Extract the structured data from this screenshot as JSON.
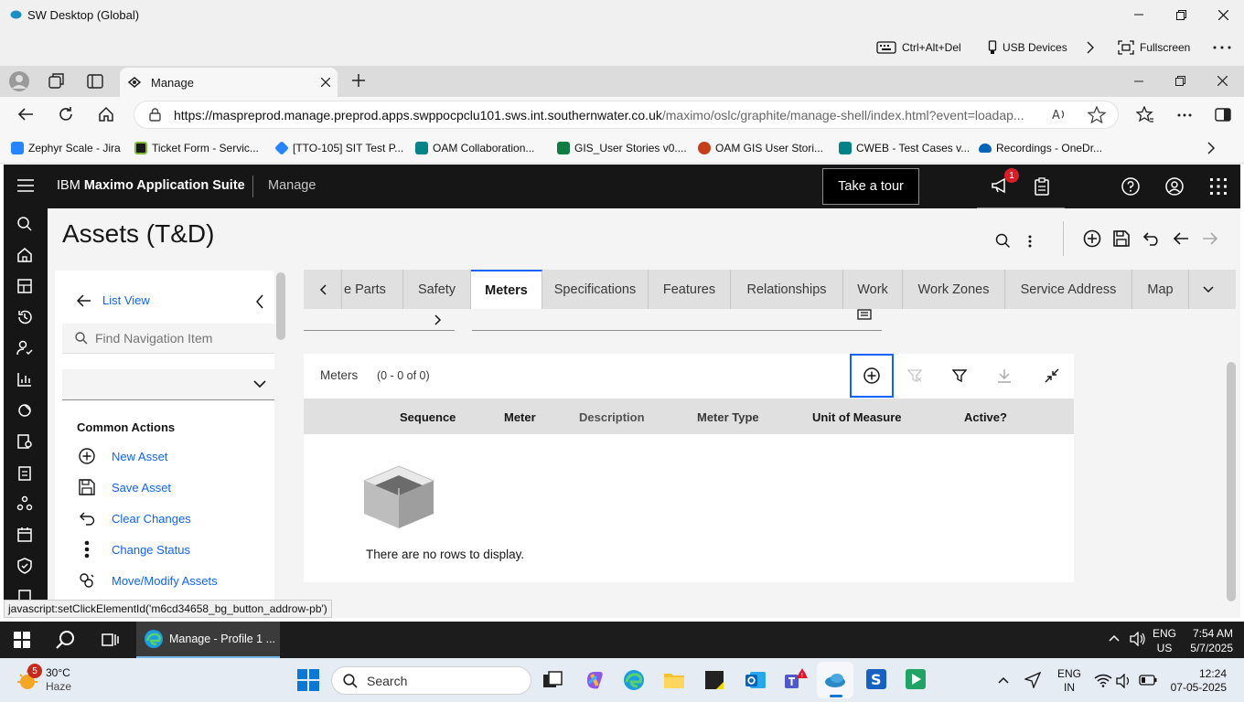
{
  "sw_window": {
    "title": "SW Desktop (Global)",
    "toolbar": {
      "ctrl_alt_del": "Ctrl+Alt+Del",
      "usb": "USB Devices",
      "fullscreen": "Fullscreen"
    }
  },
  "browser": {
    "tab_title": "Manage",
    "url_host": "https://maspreprod.manage.preprod.apps.swppocpclu101.sws.int.southernwater.co.uk",
    "url_path": "/maximo/oslc/graphite/manage-shell/index.html?event=loadap...",
    "favorites": [
      {
        "label": "Zephyr Scale - Jira",
        "color": "#2684ff"
      },
      {
        "label": "Ticket Form - Servic...",
        "color": "#1a1a1a"
      },
      {
        "label": "[TTO-105] SIT Test P...",
        "color": "#2684ff"
      },
      {
        "label": "OAM Collaboration...",
        "color": "#038387"
      },
      {
        "label": "GIS_User Stories v0....",
        "color": "#107c41"
      },
      {
        "label": "OAM GIS User Stori...",
        "color": "#c43e1c"
      },
      {
        "label": "CWEB - Test Cases v...",
        "color": "#038387"
      },
      {
        "label": "Recordings - OneDr...",
        "color": "#0364b8"
      }
    ]
  },
  "maximo": {
    "brand_plain": "IBM ",
    "brand_bold": "Maximo Application Suite",
    "app": "Manage",
    "tour_button": "Take a tour",
    "notification_count": "1",
    "page_title": "Assets (T&D)",
    "nav": {
      "list_view": "List View",
      "search_placeholder": "Find Navigation Item",
      "section_title": "Common Actions",
      "actions": [
        {
          "label": "New Asset",
          "icon": "add-circle-icon"
        },
        {
          "label": "Save Asset",
          "icon": "save-icon"
        },
        {
          "label": "Clear Changes",
          "icon": "undo-icon"
        },
        {
          "label": "Change Status",
          "icon": "overflow-vertical-icon"
        },
        {
          "label": "Move/Modify Assets",
          "icon": "move-icon"
        }
      ]
    },
    "tabs": [
      {
        "label": "e Parts"
      },
      {
        "label": "Safety"
      },
      {
        "label": "Meters",
        "active": true
      },
      {
        "label": "Specifications"
      },
      {
        "label": "Features"
      },
      {
        "label": "Relationships"
      },
      {
        "label": "Work"
      },
      {
        "label": "Work Zones"
      },
      {
        "label": "Service Address"
      },
      {
        "label": "Map"
      }
    ],
    "meters": {
      "title": "Meters",
      "count": "(0 - 0 of 0)",
      "columns": [
        "Sequence",
        "Meter",
        "Description",
        "Meter Type",
        "Unit of Measure",
        "Active?"
      ],
      "empty_message": "There are no rows to display."
    }
  },
  "status_bar": "javascript:setClickElementId('m6cd34658_bg_button_addrow-pb')",
  "remote_taskbar": {
    "task_label": "Manage - Profile 1 ...",
    "lang": "ENG",
    "region": "US",
    "time": "7:54 AM",
    "date": "5/7/2025"
  },
  "host_taskbar": {
    "weather_badge": "5",
    "temp": "30°C",
    "condition": "Haze",
    "search": "Search",
    "lang": "ENG",
    "region": "IN",
    "time": "12:24",
    "date": "07-05-2025"
  }
}
